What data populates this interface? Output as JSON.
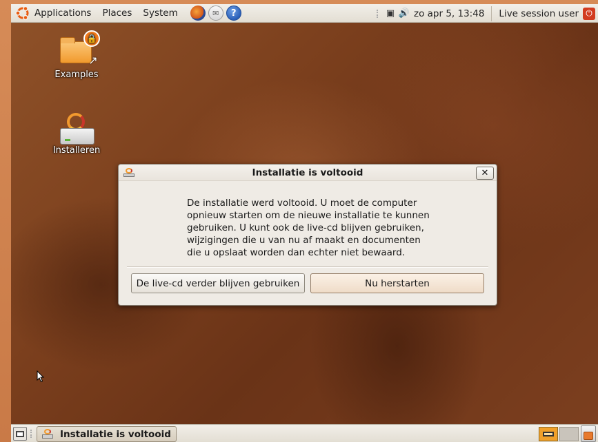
{
  "top_panel": {
    "menus": [
      "Applications",
      "Places",
      "System"
    ],
    "clock": "zo apr  5, 13:48",
    "user": "Live session user",
    "launchers": [
      "firefox-icon",
      "mail-icon",
      "help-icon"
    ]
  },
  "desktop": {
    "icons": [
      {
        "label": "Examples",
        "icon": "folder-icon"
      },
      {
        "label": "Installeren",
        "icon": "installer-icon"
      }
    ]
  },
  "dialog": {
    "title": "Installatie is voltooid",
    "close_label": "✕",
    "message_lines": [
      "De installatie werd voltooid. U moet de computer",
      "opnieuw starten om de nieuwe installatie te kunnen",
      "gebruiken. U kunt ook de live-cd blijven gebruiken,",
      "wijzigingen die u van nu af maakt en documenten",
      "die u opslaat worden dan echter niet bewaard."
    ],
    "buttons": {
      "live": "De live-cd verder blijven gebruiken",
      "restart": "Nu herstarten"
    }
  },
  "bottom_panel": {
    "task": "Installatie is voltooid"
  },
  "colors": {
    "accent": "#f07a1c",
    "panel": "#ebe7e0",
    "wallpaper": "#7b3f1d"
  }
}
